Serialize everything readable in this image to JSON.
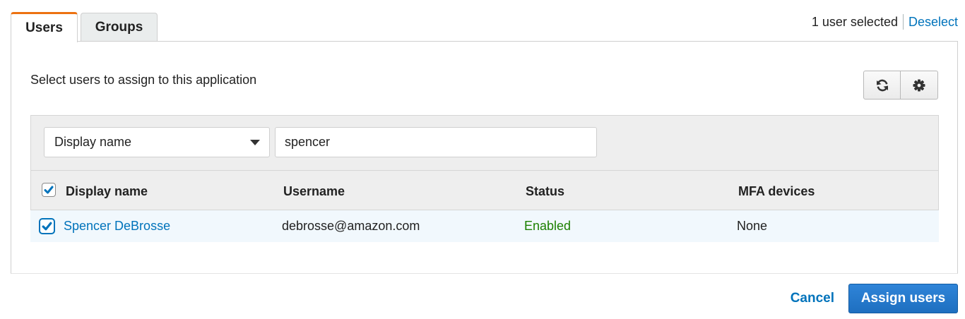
{
  "tabs": [
    {
      "label": "Users",
      "active": true
    },
    {
      "label": "Groups",
      "active": false
    }
  ],
  "selection": {
    "count_text": "1 user selected",
    "deselect_label": "Deselect"
  },
  "panel": {
    "title": "Select users to assign to this application"
  },
  "toolbar": {
    "refresh_icon": "refresh-icon",
    "settings_icon": "gear-icon"
  },
  "filter": {
    "attribute": "Display name",
    "query": "spencer"
  },
  "table": {
    "columns": [
      "Display name",
      "Username",
      "Status",
      "MFA devices"
    ],
    "select_all_checked": true,
    "rows": [
      {
        "checked": true,
        "display_name": "Spencer DeBrosse",
        "username": "debrosse@amazon.com",
        "status": "Enabled",
        "mfa_devices": "None"
      }
    ]
  },
  "footer": {
    "cancel_label": "Cancel",
    "assign_label": "Assign users"
  },
  "colors": {
    "accent": "#ec7211",
    "link": "#0073bb",
    "status_enabled": "#1d8102",
    "primary_button": "#1e6fc0",
    "selected_row": "#f1f8fd"
  }
}
